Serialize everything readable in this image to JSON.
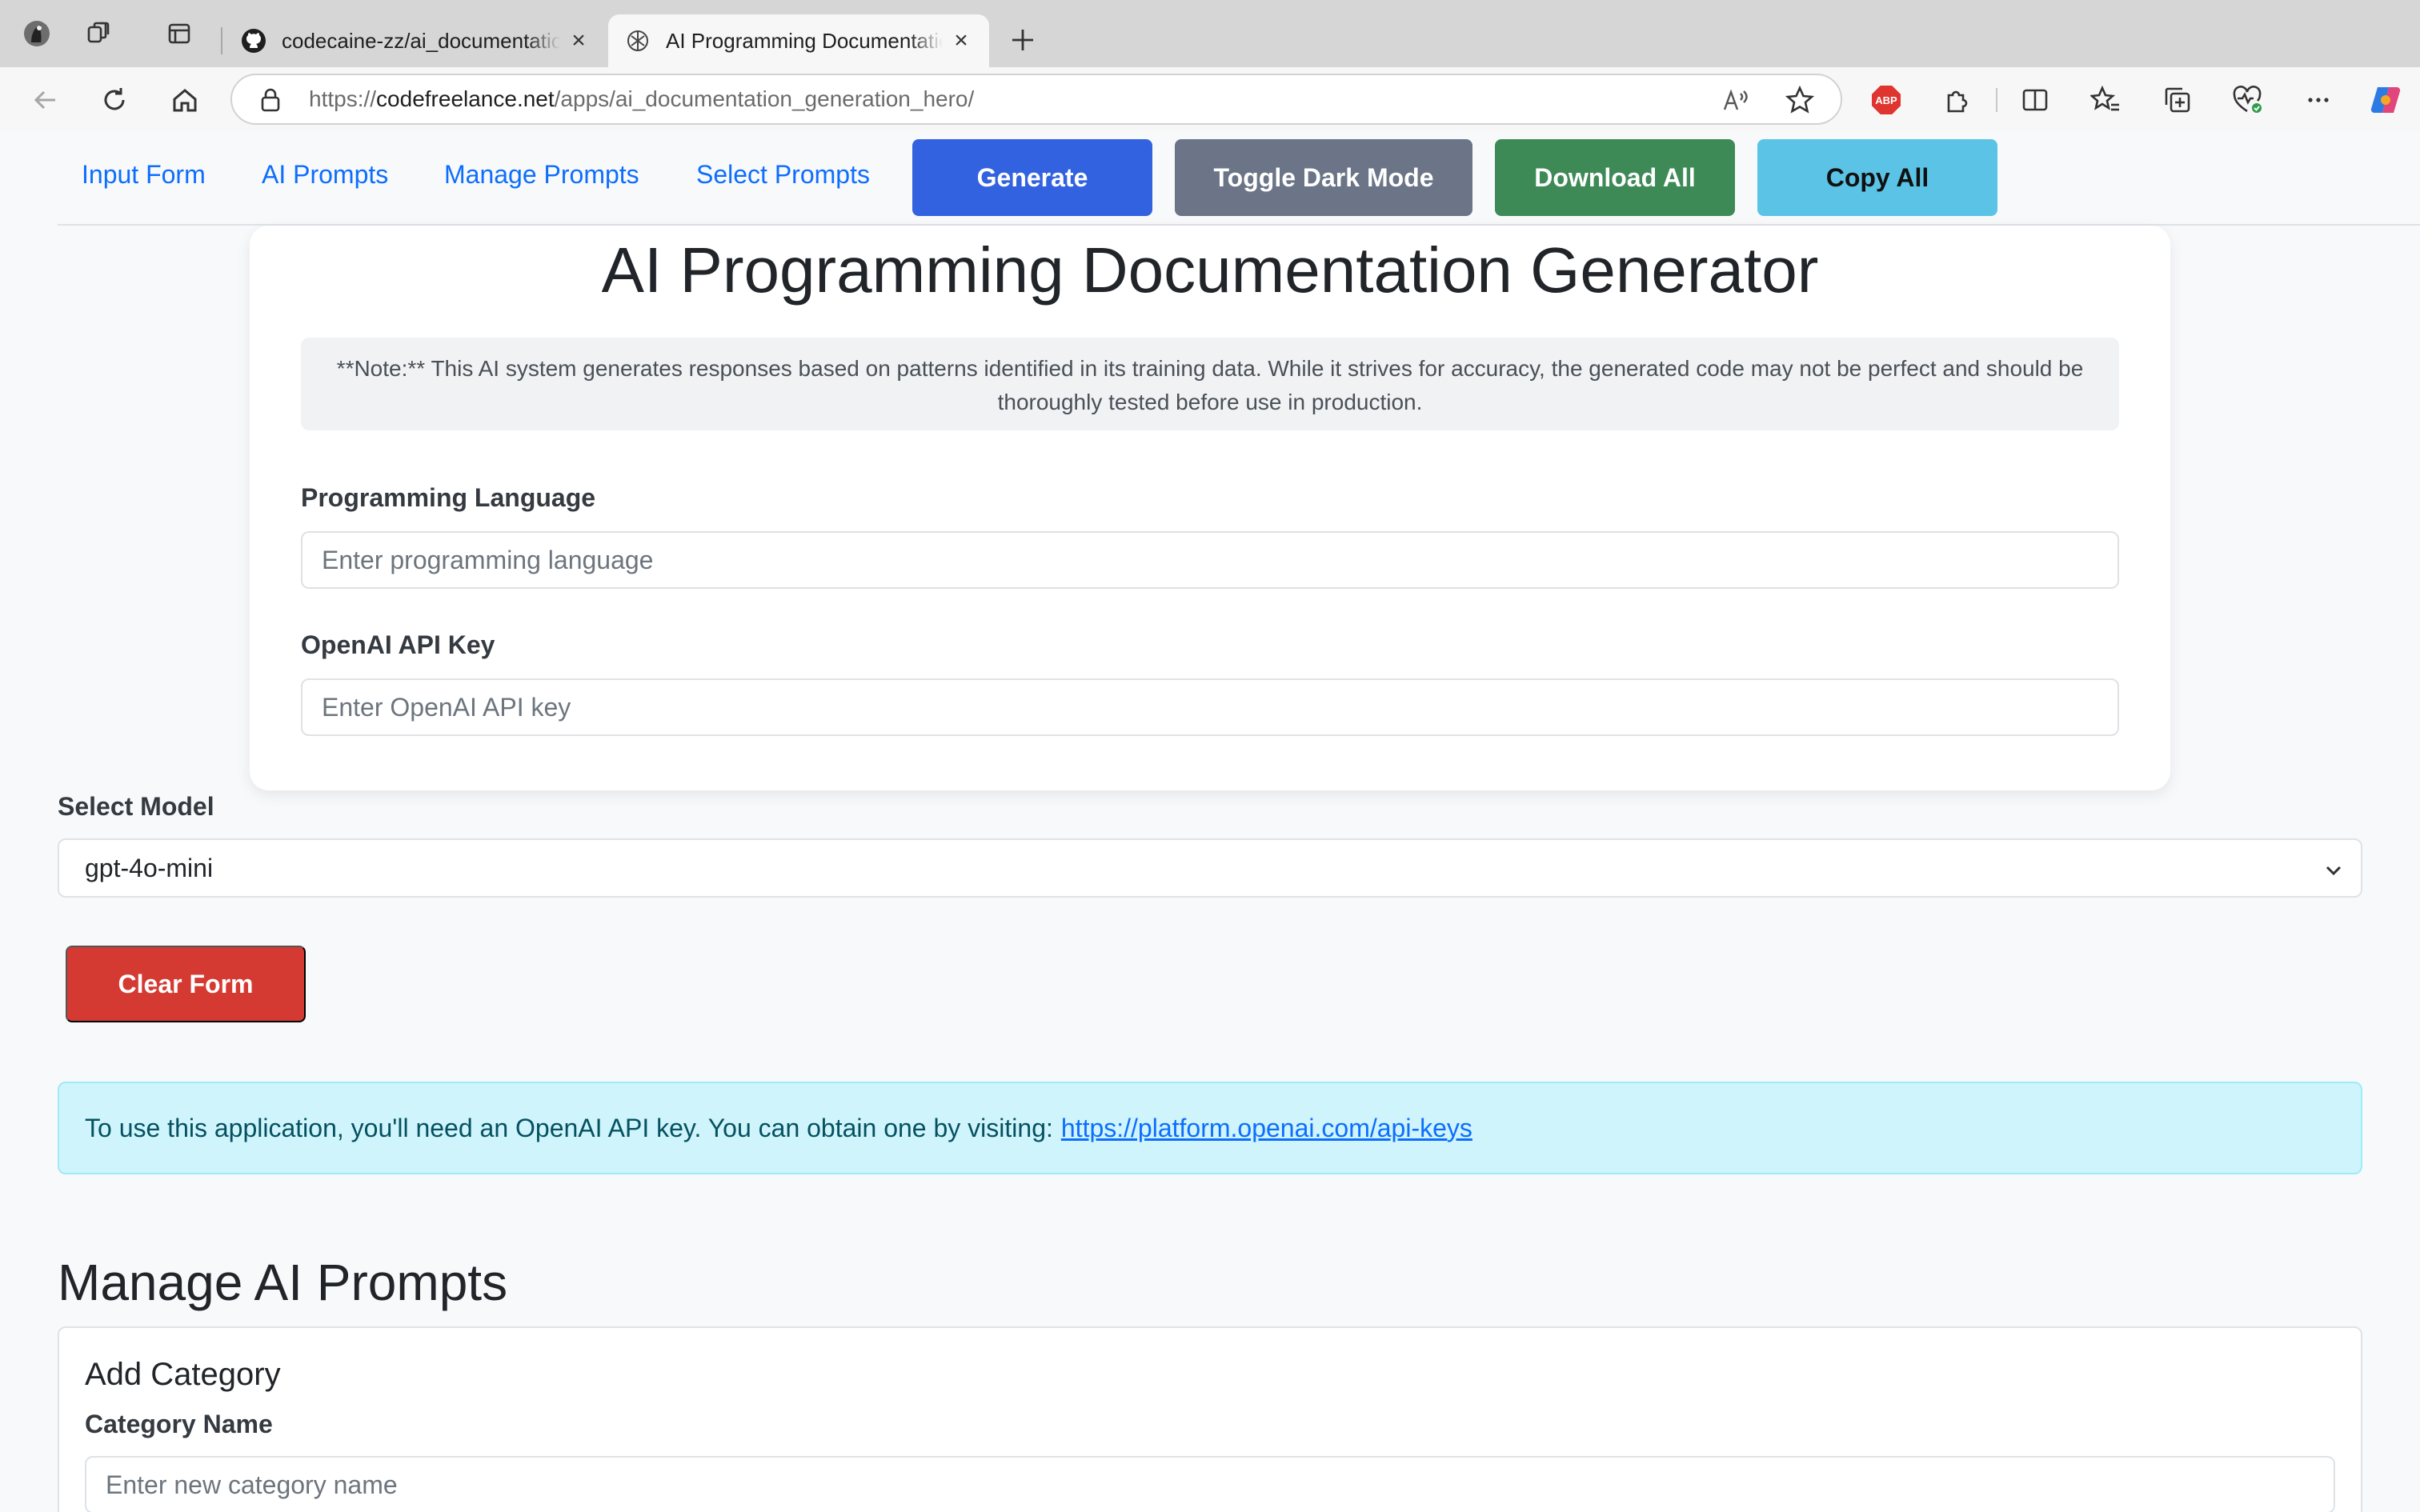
{
  "browser": {
    "tabs": [
      {
        "title": "codecaine-zz/ai_documentation_generation_hero",
        "active": false
      },
      {
        "title": "AI Programming Documentation Generator",
        "active": true
      }
    ],
    "url": {
      "scheme": "https://",
      "host": "codefreelance.net",
      "path": "/apps/ai_documentation_generation_hero/"
    },
    "toolbar_icons": [
      "back-icon",
      "refresh-icon",
      "home-icon",
      "read-aloud-icon",
      "favorite-star-icon",
      "adblock-icon",
      "extensions-icon",
      "split-screen-icon",
      "favorites-icon",
      "collections-icon",
      "browser-essentials-icon",
      "more-icon",
      "copilot-icon"
    ],
    "adblock_label": "ABP"
  },
  "nav": {
    "links": [
      "Input Form",
      "AI Prompts",
      "Manage Prompts",
      "Select Prompts"
    ],
    "buttons": {
      "generate": "Generate",
      "toggle_dark": "Toggle Dark Mode",
      "download_all": "Download All",
      "copy_all": "Copy All"
    },
    "colors": {
      "generate": "#3262e0",
      "toggle_dark": "#6b7587",
      "download_all": "#3e8a57",
      "copy_all": "#5bc4e6"
    }
  },
  "main": {
    "title": "AI Programming Documentation Generator",
    "note": "**Note:** This AI system generates responses based on patterns identified in its training data. While it strives for accuracy, the generated code may not be perfect and should be thoroughly tested before use in production.",
    "language_label": "Programming Language",
    "language_placeholder": "Enter programming language",
    "apikey_label": "OpenAI API Key",
    "apikey_placeholder": "Enter OpenAI API key"
  },
  "model": {
    "label": "Select Model",
    "selected": "gpt-4o-mini"
  },
  "clear_button": "Clear Form",
  "alert": {
    "text": "To use this application, you'll need an OpenAI API key. You can obtain one by visiting:",
    "link": "https://platform.openai.com/api-keys"
  },
  "manage": {
    "title": "Manage AI Prompts",
    "add_category_title": "Add Category",
    "category_label": "Category Name",
    "category_placeholder": "Enter new category name"
  }
}
